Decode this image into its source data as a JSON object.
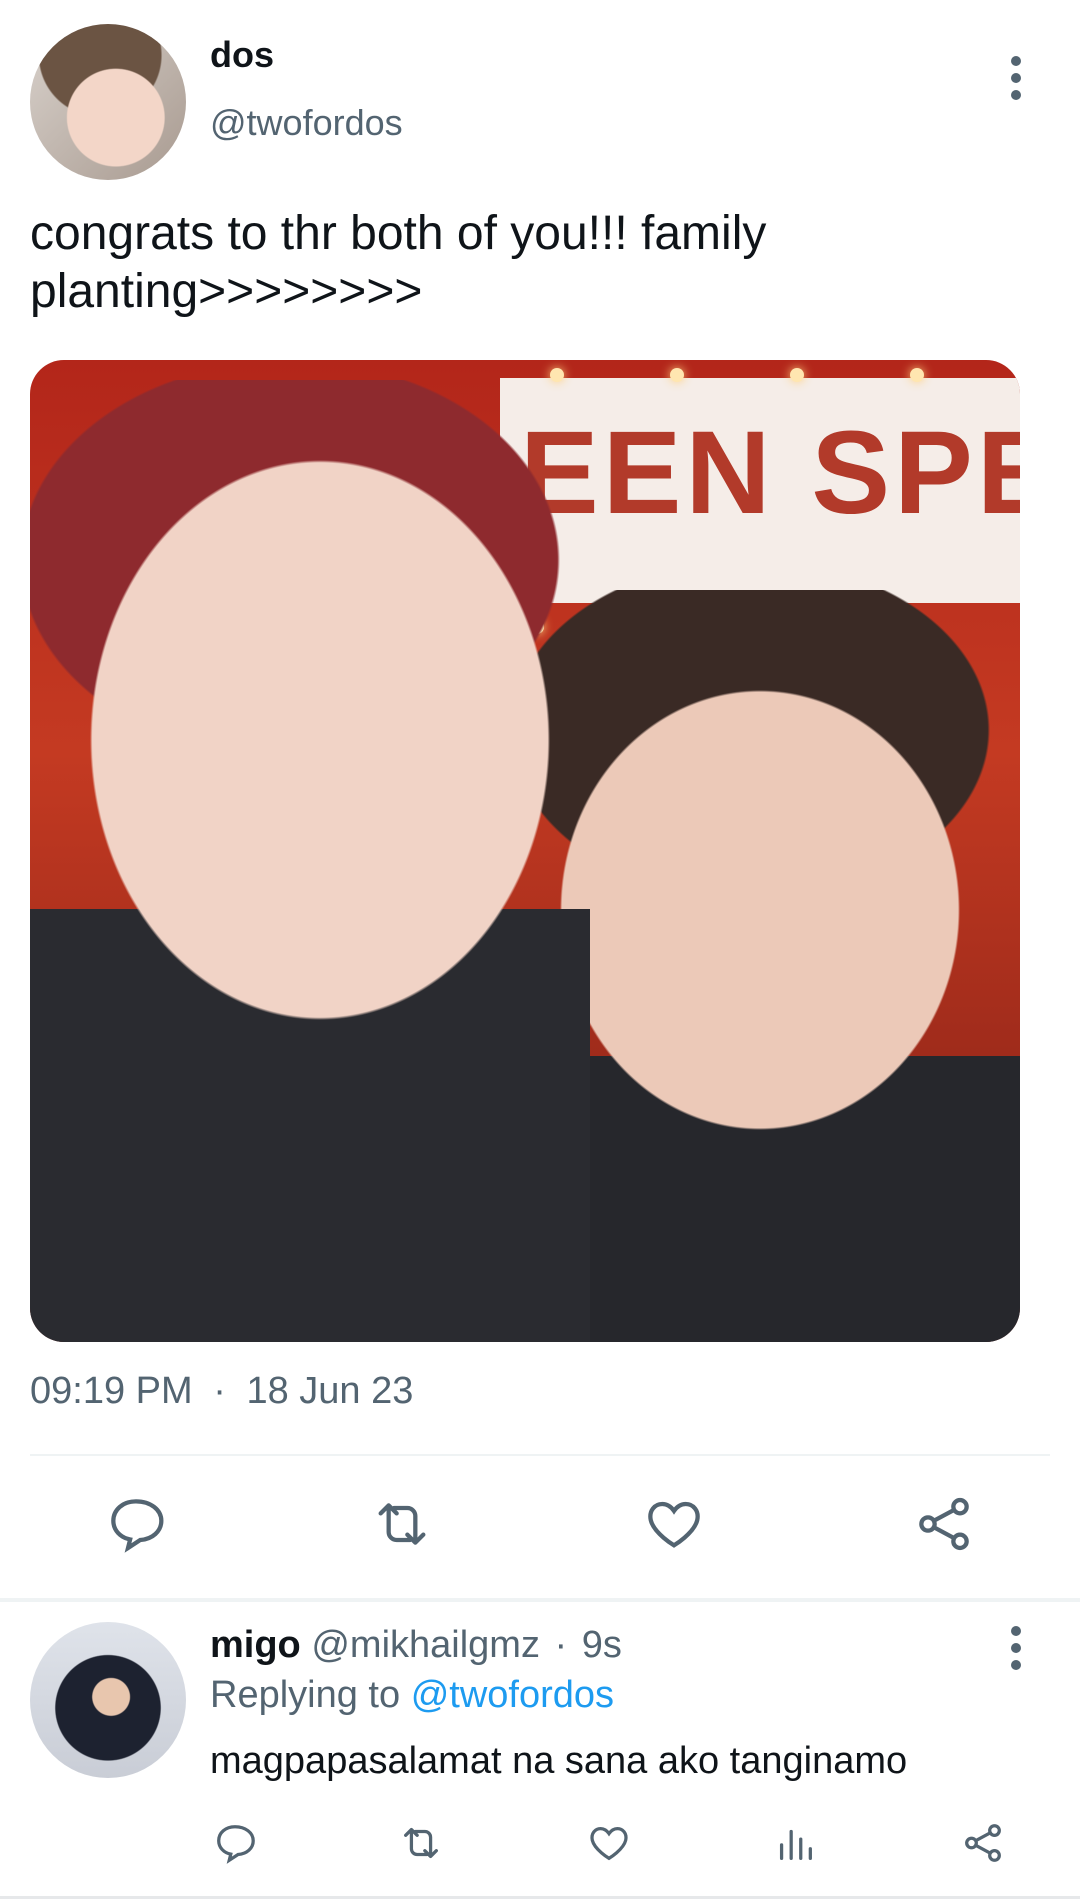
{
  "tweet": {
    "author_name": "dos",
    "author_handle": "@twofordos",
    "text": "congrats to thr both of you!!! family\nplanting>>>>>>>>",
    "image_sign_text": "EEN SPE",
    "timestamp": "09:19 PM",
    "separator": "·",
    "date": "18 Jun 23",
    "actions": [
      {
        "icon": "reply-icon"
      },
      {
        "icon": "retweet-icon"
      },
      {
        "icon": "like-icon"
      },
      {
        "icon": "share-icon"
      }
    ]
  },
  "reply": {
    "author_name": "migo",
    "author_handle": "@mikhailgmz",
    "separator": "·",
    "time": "9s",
    "replying_prefix": "Replying to",
    "replying_to": "@twofordos",
    "text": "magpapasalamat na sana ako tanginamo",
    "actions": [
      {
        "icon": "reply-icon"
      },
      {
        "icon": "retweet-icon"
      },
      {
        "icon": "like-icon"
      },
      {
        "icon": "analytics-icon"
      },
      {
        "icon": "share-icon"
      }
    ]
  },
  "colors": {
    "text": "#0f1419",
    "secondary": "#536471",
    "link": "#1d9bf0",
    "divider": "#eff3f4"
  }
}
